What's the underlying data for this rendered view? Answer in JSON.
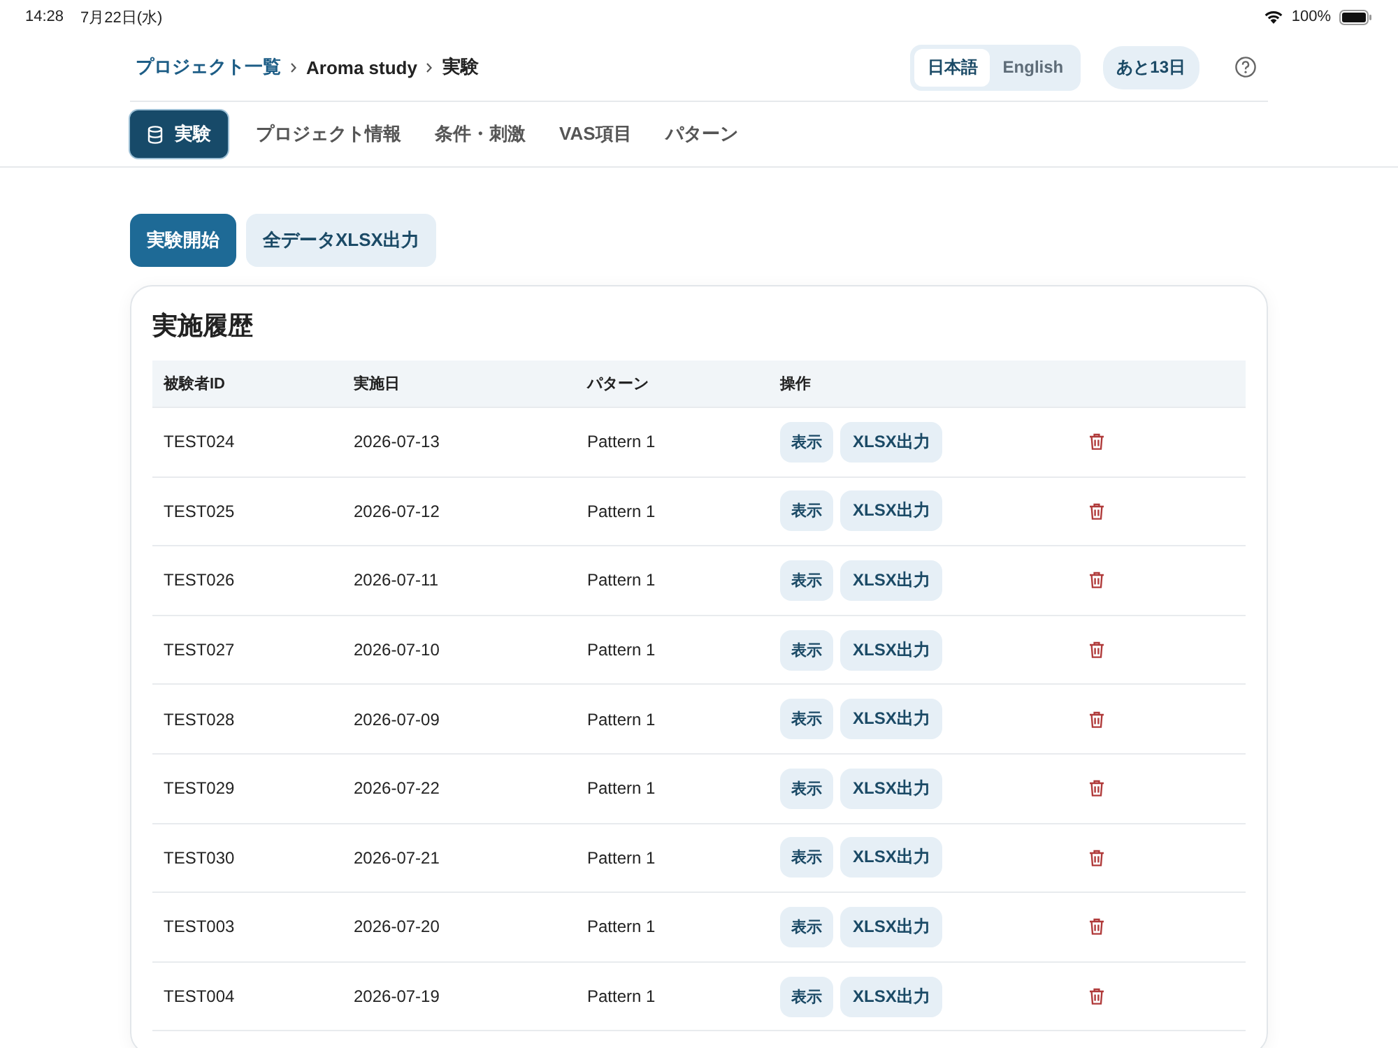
{
  "status_bar": {
    "time": "14:28",
    "date": "7月22日(水)",
    "battery": "100%"
  },
  "breadcrumb": [
    {
      "label": "プロジェクト一覧",
      "link": true
    },
    {
      "label": "Aroma study",
      "link": false
    },
    {
      "label": "実験",
      "link": false
    }
  ],
  "language": [
    {
      "label": "日本語",
      "selected": true
    },
    {
      "label": "English",
      "selected": false
    }
  ],
  "trial_badge": "あと13日",
  "tabs": [
    {
      "label": "実験",
      "selected": true
    },
    {
      "label": "プロジェクト情報",
      "selected": false
    },
    {
      "label": "条件・刺激",
      "selected": false
    },
    {
      "label": "VAS項目",
      "selected": false
    },
    {
      "label": "パターン",
      "selected": false
    }
  ],
  "actions": [
    {
      "label": "実験開始",
      "kind": "primary"
    },
    {
      "label": "全データXLSX出力",
      "kind": "secondary"
    }
  ],
  "history": {
    "title": "実施履歴",
    "columns": [
      "被験者ID",
      "実施日",
      "パターン",
      "操作"
    ],
    "rows": [
      {
        "id": "TEST024",
        "date": "2026-07-13",
        "pattern": "Pattern 1",
        "view": "表示",
        "export": "XLSX出力"
      },
      {
        "id": "TEST025",
        "date": "2026-07-12",
        "pattern": "Pattern 1",
        "view": "表示",
        "export": "XLSX出力"
      },
      {
        "id": "TEST026",
        "date": "2026-07-11",
        "pattern": "Pattern 1",
        "view": "表示",
        "export": "XLSX出力"
      },
      {
        "id": "TEST027",
        "date": "2026-07-10",
        "pattern": "Pattern 1",
        "view": "表示",
        "export": "XLSX出力"
      },
      {
        "id": "TEST028",
        "date": "2026-07-09",
        "pattern": "Pattern 1",
        "view": "表示",
        "export": "XLSX出力"
      },
      {
        "id": "TEST029",
        "date": "2026-07-22",
        "pattern": "Pattern 1",
        "view": "表示",
        "export": "XLSX出力"
      },
      {
        "id": "TEST030",
        "date": "2026-07-21",
        "pattern": "Pattern 1",
        "view": "表示",
        "export": "XLSX出力"
      },
      {
        "id": "TEST003",
        "date": "2026-07-20",
        "pattern": "Pattern 1",
        "view": "表示",
        "export": "XLSX出力"
      },
      {
        "id": "TEST004",
        "date": "2026-07-19",
        "pattern": "Pattern 1",
        "view": "表示",
        "export": "XLSX出力"
      }
    ]
  }
}
